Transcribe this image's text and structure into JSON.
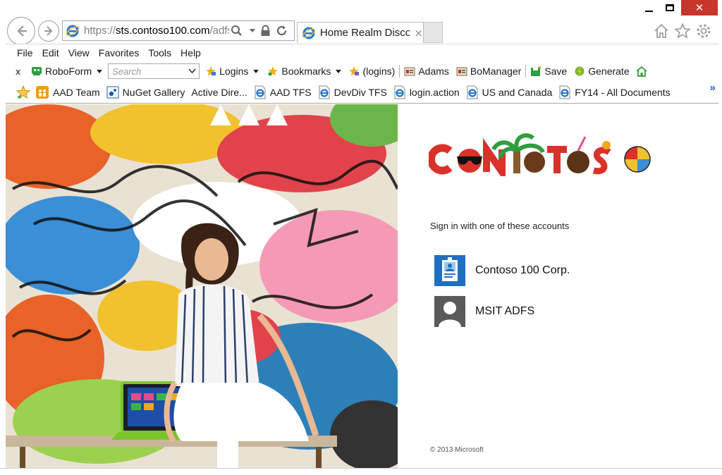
{
  "window": {
    "close_glyph": "✕",
    "address_prefix": "https://",
    "address_domain": "sts.contoso100.com",
    "address_path": "/adfs/ls",
    "tab_title": "Home Realm Disco...",
    "tab_close": "×"
  },
  "menu": [
    "File",
    "Edit",
    "View",
    "Favorites",
    "Tools",
    "Help"
  ],
  "robo": {
    "close": "x",
    "roboform": "RoboForm",
    "search_placeholder": "Search",
    "logins": "Logins",
    "bookmarks": "Bookmarks",
    "logins_paren": "(logins)",
    "adams": "Adams",
    "bomanager": "BoManager",
    "save": "Save",
    "generate": "Generate"
  },
  "favorites": [
    {
      "label": "AAD Team",
      "icon": "team-icon"
    },
    {
      "label": "NuGet Gallery",
      "icon": "nuget-icon"
    },
    {
      "label": "Active Dire...",
      "icon": "none"
    },
    {
      "label": "AAD TFS",
      "icon": "ie-page-icon"
    },
    {
      "label": "DevDiv TFS",
      "icon": "ie-page-icon"
    },
    {
      "label": "login.action",
      "icon": "ie-page-icon"
    },
    {
      "label": "US and Canada",
      "icon": "ie-page-icon"
    },
    {
      "label": "FY14 - All Documents",
      "icon": "ie-page-icon"
    }
  ],
  "favorites_more": "»",
  "signin": {
    "prompt": "Sign in with one of these accounts",
    "accounts": [
      {
        "label": "Contoso 100 Corp.",
        "tile_color": "#1f6fc0"
      },
      {
        "label": "MSIT ADFS",
        "tile_color": "#5a5a5a"
      }
    ],
    "footer": "© 2013 Microsoft"
  },
  "colors": {
    "close_button": "#c8352b",
    "ie_blue": "#1b78d0",
    "favorites_chevron": "#1c5fd0"
  }
}
